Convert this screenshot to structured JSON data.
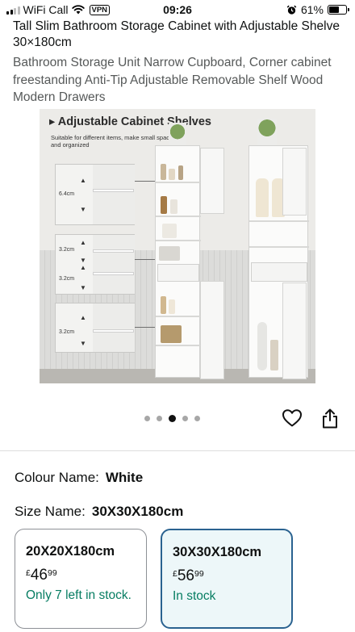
{
  "status_bar": {
    "carrier": "WiFi Call",
    "vpn": "VPN",
    "time": "09:26",
    "battery": "61%",
    "battery_level": 0.61
  },
  "product": {
    "title": "Tall Slim Bathroom Storage Cabinet with Adjustable Shelve 30×180cm",
    "subtitle": "Bathroom Storage Unit Narrow Cupboard, Corner cabinet freestanding Anti-Tip Adjustable Removable Shelf Wood Modern Drawers"
  },
  "image": {
    "heading": "Adjustable Cabinet Shelves",
    "note": "Suitable for different items, make small space neat and organized",
    "dimensions": [
      "6.4cm",
      "3.2cm",
      "3.2cm",
      "3.2cm"
    ]
  },
  "carousel": {
    "total": 5,
    "active_index": 3,
    "icons": {
      "favorite": "heart-icon",
      "share": "share-icon"
    }
  },
  "colour": {
    "label": "Colour Name:",
    "value": "White"
  },
  "size": {
    "label": "Size Name:",
    "value": "30X30X180cm",
    "options": [
      {
        "name": "20X20X180cm",
        "currency": "£",
        "price_whole": "46",
        "price_fraction": "99",
        "stock": "Only 7 left in stock.",
        "selected": false
      },
      {
        "name": "30X30X180cm",
        "currency": "£",
        "price_whole": "56",
        "price_fraction": "99",
        "stock": "In stock",
        "selected": true
      }
    ]
  },
  "colors": {
    "in_stock_green": "#067d62",
    "selected_border": "#2a6290",
    "selected_background": "#edf7f9",
    "secondary_text": "#565959"
  }
}
